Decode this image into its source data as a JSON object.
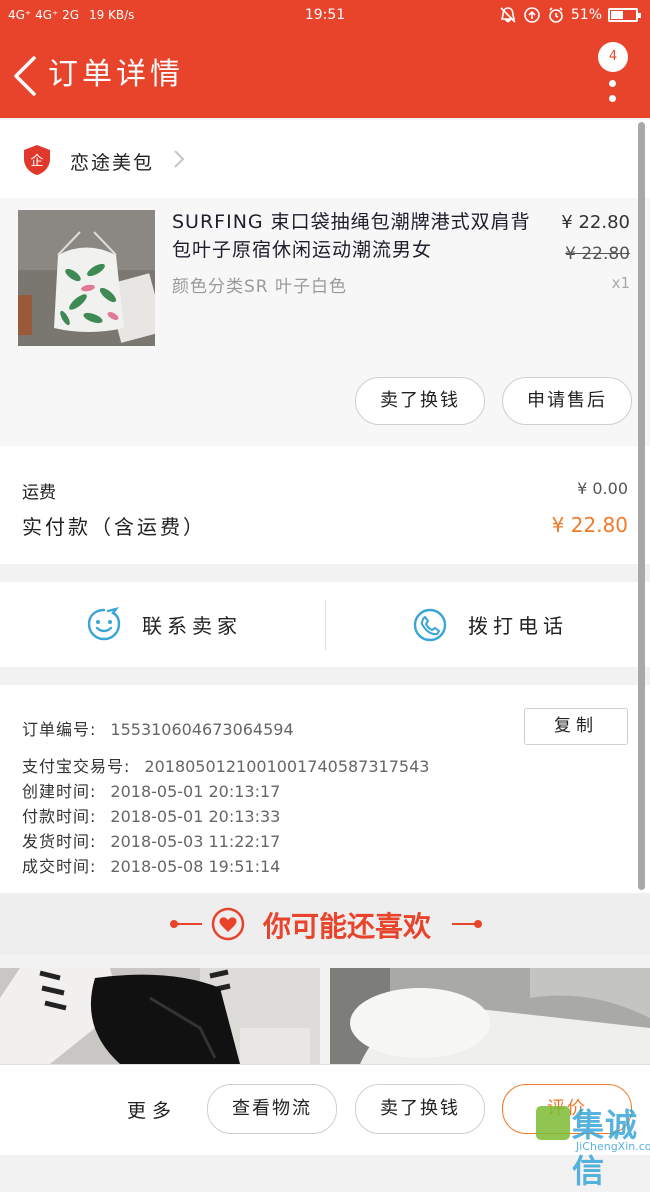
{
  "status_bar": {
    "network": "4G⁺ 4G⁺ 2G",
    "speed": "19 KB/s",
    "time": "19:51",
    "battery": "51%",
    "battery_level": 0.51
  },
  "header": {
    "title": "订单详情",
    "badge_count": "4"
  },
  "shop": {
    "logo_text": "企",
    "name": "恋途美包"
  },
  "product": {
    "title": "SURFING 束口袋抽绳包潮牌港式双肩背包叶子原宿休闲运动潮流男女",
    "spec": "颜色分类SR 叶子白色",
    "price": "¥ 22.80",
    "original_price": "¥ 22.80",
    "quantity": "x1",
    "actions": [
      "卖了换钱",
      "申请售后"
    ]
  },
  "fees": {
    "shipping_label": "运费",
    "shipping_value": "¥ 0.00",
    "paid_label": "实付款（含运费）",
    "paid_value": "¥ 22.80"
  },
  "contact": {
    "seller_label": "联系卖家",
    "call_label": "拨打电话"
  },
  "order_info": {
    "copy_label": "复制",
    "lines": [
      {
        "label": "订单编号:",
        "value": "155310604673064594"
      },
      {
        "label": "支付宝交易号:",
        "value": "2018050121001001740587317543"
      },
      {
        "label": "创建时间:",
        "value": "2018-05-01 20:13:17"
      },
      {
        "label": "付款时间:",
        "value": "2018-05-01 20:13:33"
      },
      {
        "label": "发货时间:",
        "value": "2018-05-03 11:22:17"
      },
      {
        "label": "成交时间:",
        "value": "2018-05-08 19:51:14"
      }
    ]
  },
  "recommend": {
    "title": "你可能还喜欢"
  },
  "bottom_bar": {
    "more": "更多",
    "logistics": "查看物流",
    "sell": "卖了换钱",
    "review": "评价"
  },
  "watermark": {
    "text": "集诚信",
    "url": "JiChengXin.com"
  },
  "colors": {
    "brand": "#e8442c",
    "accent": "#f07a2a",
    "contact_icon": "#3aa5d8"
  }
}
